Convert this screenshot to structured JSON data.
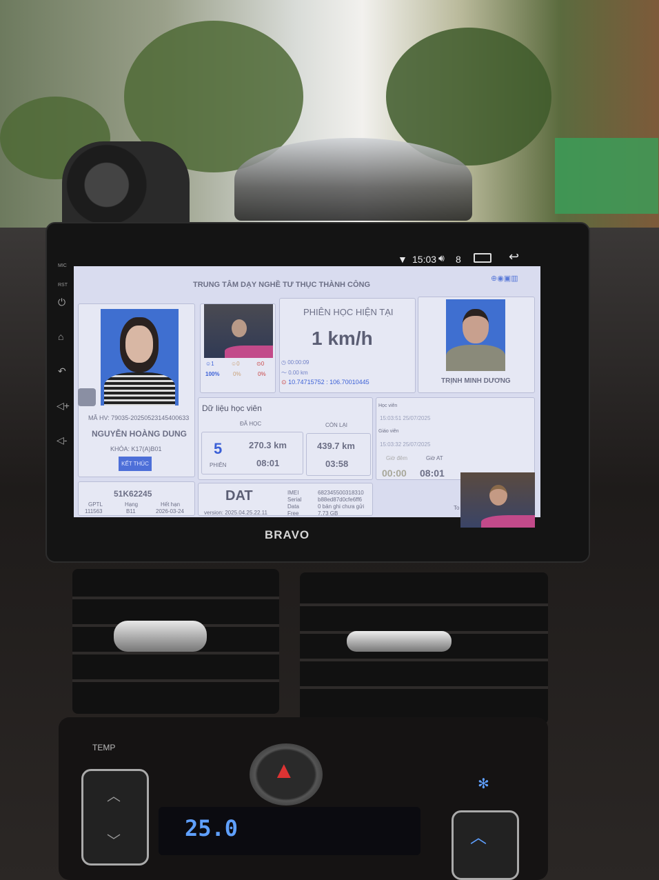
{
  "status_bar": {
    "time": "15:03",
    "volume": "8"
  },
  "side_labels": {
    "mic": "MIC",
    "rst": "RST"
  },
  "header": {
    "title": "TRUNG TÂM DẠY NGHỀ TƯ THỤC THÀNH CÔNG"
  },
  "student": {
    "ma_hv": "MÃ HV: 79035-20250523145400633",
    "name": "NGUYỄN HOÀNG DUNG",
    "khoa": "KHÓA: K17(A)B01",
    "end_button": "KẾT THÚC"
  },
  "camera": {
    "stat1": "1",
    "stat1_pct": "100%",
    "stat2": "0",
    "stat2_pct": "0%",
    "stat3": "0",
    "stat3_pct": "0%"
  },
  "session": {
    "title": "PHIÊN HỌC HIỆN TẠI",
    "speed": "1 km/h",
    "duration": "00:00:09",
    "distance": "0.00 km",
    "coords": "10.74715752 : 106.70010445"
  },
  "teacher": {
    "name": "TRỊNH MINH DƯƠNG"
  },
  "student_data": {
    "title": "Dữ liệu học viên",
    "learned_label": "ĐÃ HỌC",
    "remaining_label": "CÒN LẠI",
    "sessions": "5",
    "sessions_label": "PHIÊN",
    "learned_km": "270.3 km",
    "learned_time": "08:01",
    "remaining_km": "439.7 km",
    "remaining_time": "03:58"
  },
  "login": {
    "student_label": "Học viên",
    "student_time": "15:03:51 25/07/2025",
    "teacher_label": "Giáo viên",
    "teacher_time": "15:03:32 25/07/2025",
    "night_label": "Giờ đêm",
    "auto_label": "Giờ AT",
    "night_value": "00:00",
    "auto_value": "08:01",
    "to_label": "To"
  },
  "vehicle": {
    "plate": "51K62245",
    "gptl_label": "GPTL",
    "gptl": "111563",
    "class_label": "Hạng",
    "class": "B11",
    "expiry_label": "Hết hạn",
    "expiry": "2026-03-24"
  },
  "device": {
    "name": "DAT",
    "version": "version: 2025.04.25.22.11",
    "imei_label": "IMEI",
    "imei": "682345500318310",
    "serial_label": "Serial",
    "serial": "b88ed87d0cfe6ff6",
    "data_label": "Data",
    "data": "0 bản ghi chưa gửi",
    "free_label": "Free",
    "free": "7.73 GB"
  },
  "brand": "BRAVO",
  "climate": {
    "temp_label": "TEMP",
    "temp": "25.0"
  }
}
